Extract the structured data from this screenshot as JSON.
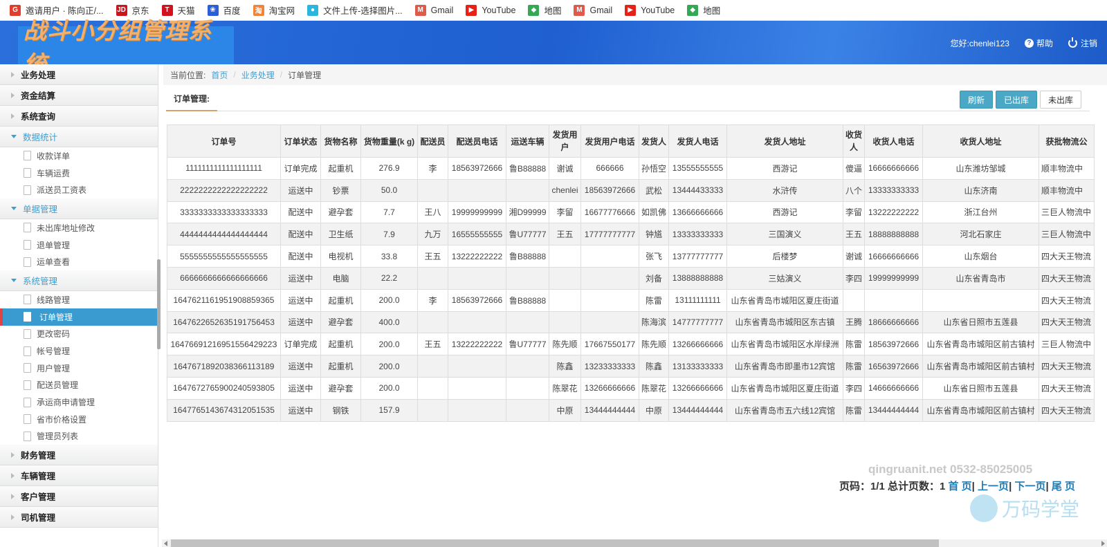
{
  "bookmarks": [
    {
      "icon": "invite-icon",
      "label": "邀请用户 · 陈向正/...",
      "color": "#e03e2d",
      "glyph": "G"
    },
    {
      "icon": "jd-icon",
      "label": "京东",
      "color": "#c9151e",
      "glyph": "JD"
    },
    {
      "icon": "tmall-icon",
      "label": "天猫",
      "color": "#d1121c",
      "glyph": "T"
    },
    {
      "icon": "baidu-icon",
      "label": "百度",
      "color": "#2b5fd9",
      "glyph": "❀"
    },
    {
      "icon": "taobao-icon",
      "label": "淘宝网",
      "color": "#f0843a",
      "glyph": "淘"
    },
    {
      "icon": "upload-icon",
      "label": "文件上传-选择图片...",
      "color": "#2bb6e0",
      "glyph": "●"
    },
    {
      "icon": "gmail-icon",
      "label": "Gmail",
      "color": "#e05a4a",
      "glyph": "M"
    },
    {
      "icon": "youtube-icon",
      "label": "YouTube",
      "color": "#e62117",
      "glyph": "▶"
    },
    {
      "icon": "maps-icon",
      "label": "地图",
      "color": "#34a853",
      "glyph": "◆"
    },
    {
      "icon": "gmail-icon",
      "label": "Gmail",
      "color": "#e05a4a",
      "glyph": "M"
    },
    {
      "icon": "youtube-icon",
      "label": "YouTube",
      "color": "#e62117",
      "glyph": "▶"
    },
    {
      "icon": "maps-icon",
      "label": "地图",
      "color": "#34a853",
      "glyph": "◆"
    }
  ],
  "header": {
    "title": "战斗小分组管理系统",
    "greeting": "您好:chenlei123",
    "help": "帮助",
    "logout": "注销"
  },
  "sidebar": {
    "groups": [
      {
        "label": "业务处理",
        "open": false,
        "items": []
      },
      {
        "label": "资金结算",
        "open": false,
        "items": []
      },
      {
        "label": "系统查询",
        "open": false,
        "items": []
      },
      {
        "label": "数据统计",
        "open": true,
        "items": [
          "收款详单",
          "车辆运费",
          "派送员工资表"
        ]
      },
      {
        "label": "单据管理",
        "open": true,
        "items": [
          "未出库地址修改",
          "退单管理",
          "运单查看"
        ]
      },
      {
        "label": "系统管理",
        "open": true,
        "items": [
          "线路管理",
          "订单管理",
          "更改密码",
          "帐号管理",
          "用户管理",
          "配送员管理",
          "承运商申请管理",
          "省市价格设置",
          "管理员列表"
        ]
      },
      {
        "label": "财务管理",
        "open": false,
        "items": []
      },
      {
        "label": "车辆管理",
        "open": false,
        "items": []
      },
      {
        "label": "客户管理",
        "open": false,
        "items": []
      },
      {
        "label": "司机管理",
        "open": false,
        "items": []
      }
    ],
    "active_item": "订单管理"
  },
  "breadcrumb": {
    "prefix": "当前位置:",
    "items": [
      "首页",
      "业务处理"
    ],
    "current": "订单管理"
  },
  "panel": {
    "title": "订单管理:",
    "buttons": {
      "refresh": "刷新",
      "shipped": "已出库",
      "unshipped": "未出库"
    }
  },
  "table": {
    "columns": [
      "订单号",
      "订单状态",
      "货物名称",
      "货物重量(k g)",
      "配送员",
      "配送员电话",
      "运送车辆",
      "发货用户",
      "发货用户电话",
      "发货人",
      "发货人电话",
      "发货人地址",
      "收货人",
      "收货人电话",
      "收货人地址",
      "获批物流公"
    ],
    "rows": [
      [
        "1111111111111111111",
        "订单完成",
        "起重机",
        "276.9",
        "李",
        "18563972666",
        "鲁B88888",
        "谢诚",
        "666666",
        "孙悟空",
        "13555555555",
        "西游记",
        "傻逼",
        "16666666666",
        "山东潍坊邹城",
        "顺丰物流中"
      ],
      [
        "2222222222222222222",
        "运送中",
        "钞票",
        "50.0",
        "",
        "",
        "",
        "chenlei",
        "18563972666",
        "武松",
        "13444433333",
        "水浒传",
        "八个",
        "13333333333",
        "山东济南",
        "顺丰物流中"
      ],
      [
        "3333333333333333333",
        "配送中",
        "避孕套",
        "7.7",
        "王八",
        "19999999999",
        "湘D99999",
        "李留",
        "16677776666",
        "如凯佛",
        "13666666666",
        "西游记",
        "李留",
        "13222222222",
        "浙江台州",
        "三巨人物流中"
      ],
      [
        "4444444444444444444",
        "配送中",
        "卫生纸",
        "7.9",
        "九万",
        "16555555555",
        "鲁U77777",
        "王五",
        "17777777777",
        "钟馗",
        "13333333333",
        "三国演义",
        "王五",
        "18888888888",
        "河北石家庄",
        "三巨人物流中"
      ],
      [
        "5555555555555555555",
        "配送中",
        "电视机",
        "33.8",
        "王五",
        "13222222222",
        "鲁B88888",
        "",
        "",
        "张飞",
        "13777777777",
        "后楼梦",
        "谢诚",
        "16666666666",
        "山东烟台",
        "四大天王物流"
      ],
      [
        "6666666666666666666",
        "运送中",
        "电脑",
        "22.2",
        "",
        "",
        "",
        "",
        "",
        "刘备",
        "13888888888",
        "三姑演义",
        "李四",
        "19999999999",
        "山东省青岛市",
        "四大天王物流"
      ],
      [
        "1647621161951908859365",
        "运送中",
        "起重机",
        "200.0",
        "李",
        "18563972666",
        "鲁B88888",
        "",
        "",
        "陈雷",
        "13111111111",
        "山东省青岛市城阳区夏庄街道",
        "",
        "",
        "",
        "四大天王物流"
      ],
      [
        "1647622652635191756453",
        "运送中",
        "避孕套",
        "400.0",
        "",
        "",
        "",
        "",
        "",
        "陈海滨",
        "14777777777",
        "山东省青岛市城阳区东古镇",
        "王腾",
        "18666666666",
        "山东省日照市五莲县",
        "四大天王物流"
      ],
      [
        "1647669121695155642922З",
        "订单完成",
        "起重机",
        "200.0",
        "王五",
        "13222222222",
        "鲁U77777",
        "陈先顺",
        "17667550177",
        "陈先顺",
        "13266666666",
        "山东省青岛市城阳区水岸绿洲",
        "陈雷",
        "18563972666",
        "山东省青岛市城阳区前古镇村",
        "三巨人物流中"
      ],
      [
        "1647671892038366113189",
        "运送中",
        "起重机",
        "200.0",
        "",
        "",
        "",
        "陈鑫",
        "13233333333",
        "陈鑫",
        "13133333333",
        "山东省青岛市即墨市12宾馆",
        "陈雷",
        "16563972666",
        "山东省青岛市城阳区前古镇村",
        "四大天王物流"
      ],
      [
        "1647672765900240593805",
        "运送中",
        "避孕套",
        "200.0",
        "",
        "",
        "",
        "陈翠花",
        "13266666666",
        "陈翠花",
        "13266666666",
        "山东省青岛市城阳区夏庄街道",
        "李四",
        "14666666666",
        "山东省日照市五莲县",
        "四大天王物流"
      ],
      [
        "1647765143674312051535",
        "运送中",
        "钢铁",
        "157.9",
        "",
        "",
        "",
        "中原",
        "13444444444",
        "中原",
        "13444444444",
        "山东省青岛市五六线12宾馆",
        "陈雷",
        "13444444444",
        "山东省青岛市城阳区前古镇村",
        "四大天王物流"
      ]
    ]
  },
  "pagination": {
    "label": "页码：1/1 总计页数：1",
    "first": "首 页",
    "prev": "上一页",
    "next": "下一页",
    "last": "尾 页",
    "sep": "|"
  },
  "watermark": {
    "site": "qingruanit.net 0532-85025005",
    "brand": "万码学堂"
  }
}
